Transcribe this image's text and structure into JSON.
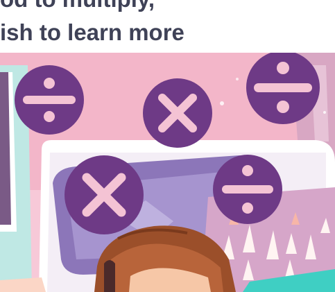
{
  "heading": {
    "line1": "od to multiply,",
    "line2": "ish to learn more"
  },
  "illustration": {
    "symbols": [
      {
        "name": "divide-icon",
        "glyph": "÷"
      },
      {
        "name": "multiply-icon",
        "glyph": "×"
      },
      {
        "name": "divide-icon",
        "glyph": "÷"
      },
      {
        "name": "multiply-icon",
        "glyph": "×"
      },
      {
        "name": "divide-icon",
        "glyph": "÷"
      }
    ],
    "colors": {
      "symbol_fill": "#6e3a86",
      "symbol_mark": "#f4c3d4",
      "wall": "#f3b6c9",
      "hair": "#9b4f2a",
      "pillow": "#8c76b9"
    }
  }
}
